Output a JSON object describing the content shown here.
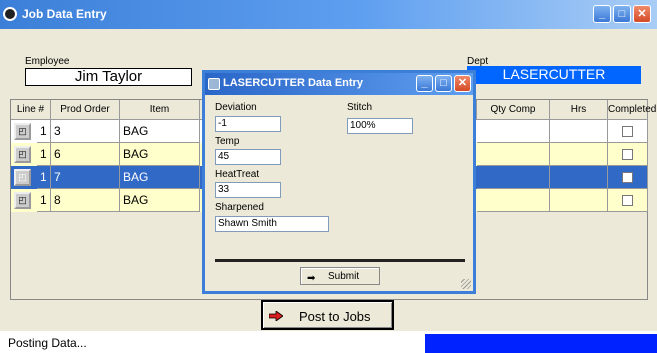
{
  "window": {
    "title": "Job Data Entry"
  },
  "employee": {
    "label": "Employee",
    "value": "Jim Taylor"
  },
  "dept": {
    "label": "Dept",
    "value": "LASERCUTTER"
  },
  "grid": {
    "headers": [
      "Line #",
      "Prod Order",
      "Item",
      "Qty Comp",
      "Hrs",
      "Completed"
    ],
    "rows": [
      {
        "line": "1",
        "prod_order": "3",
        "item": "BAG",
        "completed": false
      },
      {
        "line": "1",
        "prod_order": "6",
        "item": "BAG",
        "completed": false
      },
      {
        "line": "1",
        "prod_order": "7",
        "item": "BAG",
        "completed": true
      },
      {
        "line": "1",
        "prod_order": "8",
        "item": "BAG",
        "completed": false
      }
    ]
  },
  "dialog": {
    "title": "LASERCUTTER Data Entry",
    "fields": {
      "deviation": {
        "label": "Deviation",
        "value": "-1"
      },
      "temp": {
        "label": "Temp",
        "value": "45"
      },
      "heattreat": {
        "label": "HeatTreat",
        "value": "33"
      },
      "sharpened": {
        "label": "Sharpened",
        "value": "Shawn Smith"
      },
      "stitch": {
        "label": "Stitch",
        "value": "100%"
      }
    },
    "submit_label": "Submit"
  },
  "post_button": {
    "label": "Post to Jobs"
  },
  "status": {
    "text": "Posting Data..."
  },
  "colors": {
    "row_odd": "#ffffff",
    "row_even": "#ffffcc",
    "row_selected": "#3169c6",
    "dept_bg": "#0066ff",
    "progress": "#0022ff"
  }
}
